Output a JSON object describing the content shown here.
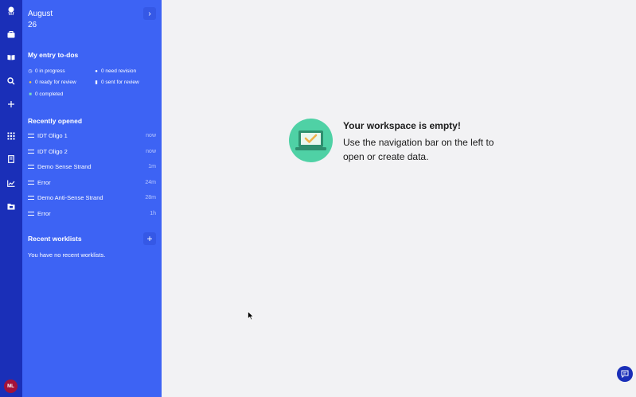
{
  "sidebar": {
    "date_month": "August",
    "date_day": "26",
    "collapse_glyph": "›",
    "todos_title": "My entry to-dos",
    "todos": [
      {
        "label": "0 in progress",
        "icon": "clock-icon"
      },
      {
        "label": "0 need revision",
        "icon": "user-edit-icon"
      },
      {
        "label": "0 ready for review",
        "icon": "review-icon"
      },
      {
        "label": "0 sent for review",
        "icon": "clipboard-icon"
      },
      {
        "label": "0 completed",
        "icon": "check-folder-icon"
      }
    ],
    "recent_title": "Recently opened",
    "recent": [
      {
        "name": "IDT Oligo 1",
        "time": "now"
      },
      {
        "name": "IDT Oligo 2",
        "time": "now"
      },
      {
        "name": "Demo Sense Strand",
        "time": "1m"
      },
      {
        "name": "Error",
        "time": "24m"
      },
      {
        "name": "Demo Anti-Sense Strand",
        "time": "28m"
      },
      {
        "name": "Error",
        "time": "1h"
      }
    ],
    "worklists_title": "Recent worklists",
    "add_glyph": "+",
    "no_worklists": "You have no recent worklists."
  },
  "nav_icons": [
    "logo-icon",
    "briefcase-icon",
    "book-icon",
    "search-icon",
    "plus-icon",
    "grid-icon",
    "notebook-icon",
    "chart-icon",
    "folder-icon"
  ],
  "user": {
    "initials": "ML"
  },
  "main": {
    "empty_title": "Your workspace is empty!",
    "empty_message": "Use the navigation bar on the left to open or create data."
  },
  "colors": {
    "rail": "#1a2fb8",
    "panel": "#3d63f4",
    "accent_green": "#4fd1a5",
    "avatar": "#a3123a"
  }
}
